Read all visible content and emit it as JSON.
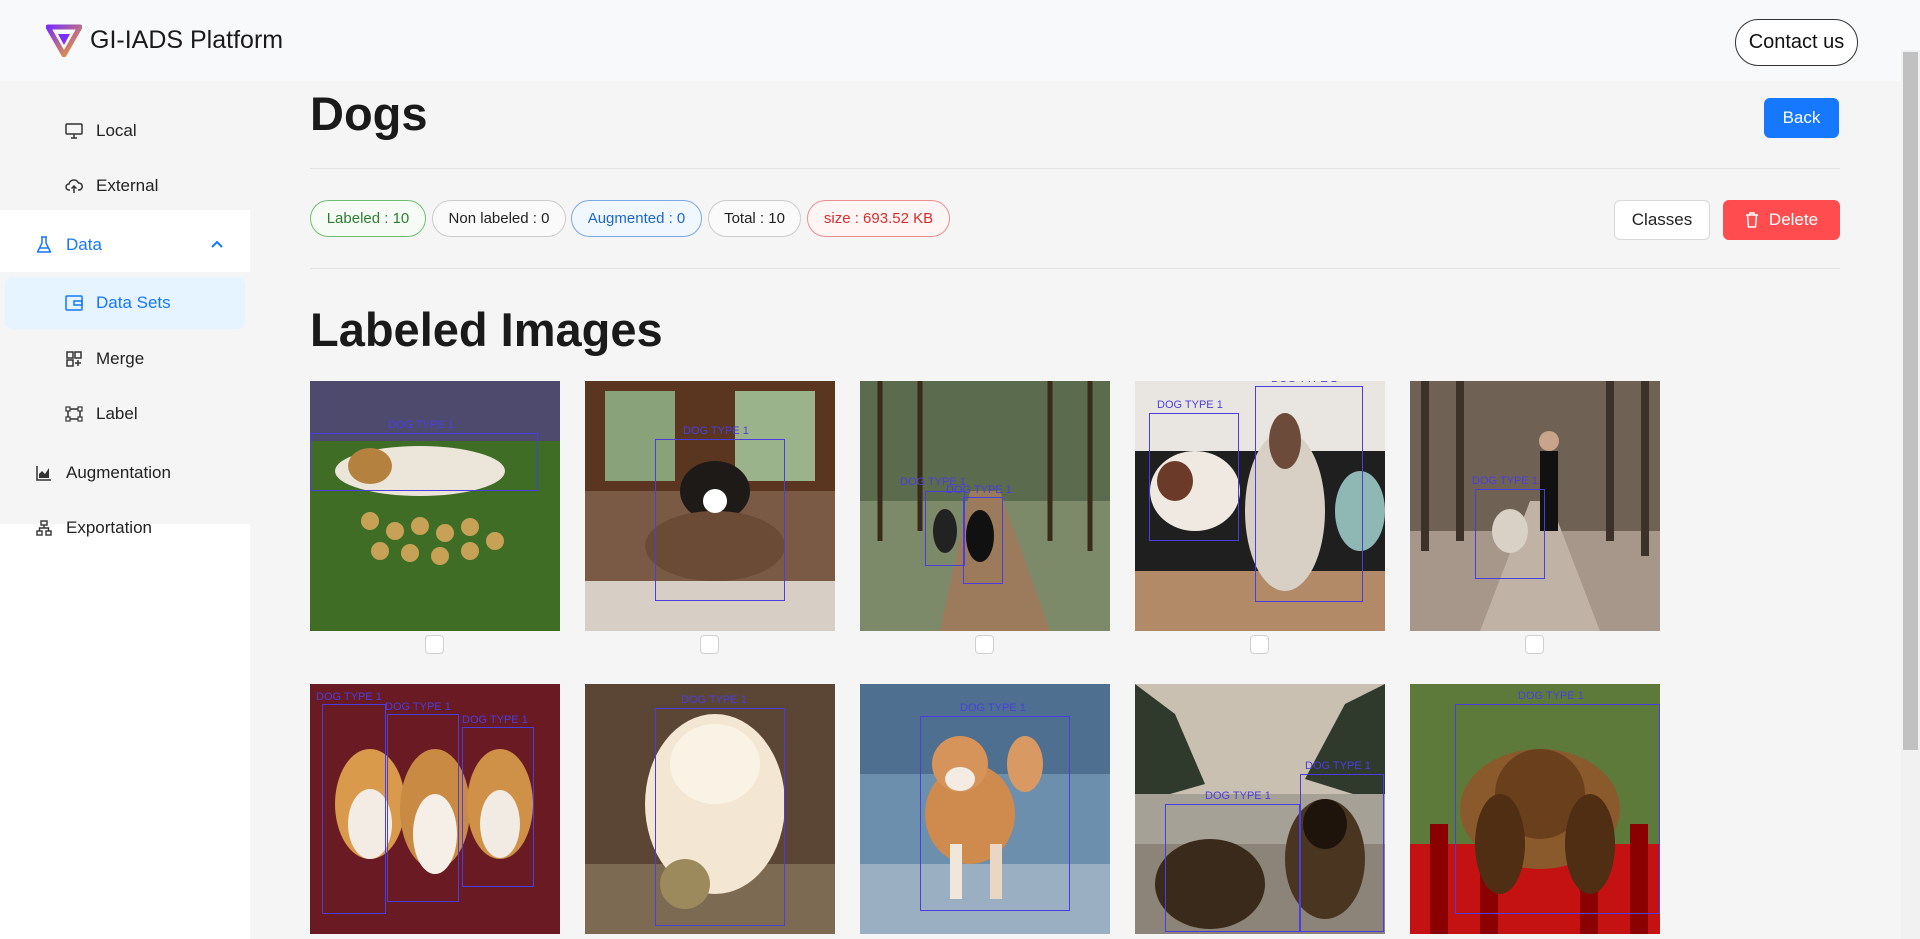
{
  "header": {
    "title": "GI-IADS Platform",
    "contact_label": "Contact us"
  },
  "sidebar": {
    "items": [
      {
        "label": "Local",
        "icon": "monitor-icon"
      },
      {
        "label": "External",
        "icon": "cloud-upload-icon"
      },
      {
        "label": "Data",
        "icon": "flask-icon"
      },
      {
        "label": "Data Sets",
        "icon": "wallet-icon"
      },
      {
        "label": "Merge",
        "icon": "merge-icon"
      },
      {
        "label": "Label",
        "icon": "bounding-box-icon"
      },
      {
        "label": "Augmentation",
        "icon": "chart-icon"
      },
      {
        "label": "Exportation",
        "icon": "hierarchy-icon"
      }
    ]
  },
  "page": {
    "title": "Dogs",
    "back_label": "Back",
    "classes_label": "Classes",
    "delete_label": "Delete",
    "section_title": "Labeled Images"
  },
  "stats": {
    "labeled": "Labeled : 10",
    "non_labeled": "Non labeled : 0",
    "augmented": "Augmented : 0",
    "total": "Total : 10",
    "size": "size : 693.52 KB"
  },
  "box_label": "DOG TYPE 1",
  "colors": {
    "primary": "#1677ff",
    "danger": "#ff4d4f",
    "bbox": "#4b3ee0"
  }
}
